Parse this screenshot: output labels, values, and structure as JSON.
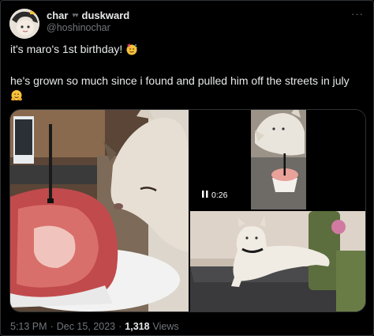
{
  "author": {
    "display_name": "char",
    "display_name_2": "duskward",
    "separator": "▾▾",
    "handle": "@hoshinochar"
  },
  "menu_icon": "more-horizontal-icon",
  "tweet": {
    "line1": "it's maro's 1st birthday! ",
    "line2": "he's grown so much since i found and pulled him off the streets in july"
  },
  "media": {
    "video_duration": "0:26",
    "video_icon": "pause-icon"
  },
  "meta": {
    "time": "5:13 PM",
    "dot1": "·",
    "date": "Dec 15, 2023",
    "dot2": "·",
    "views": "1,318",
    "views_label": "Views"
  }
}
